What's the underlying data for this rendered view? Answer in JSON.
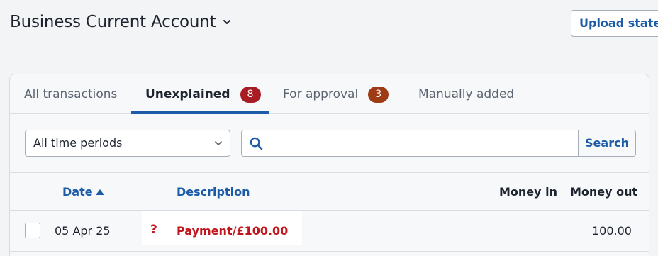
{
  "header": {
    "title": "Business Current Account",
    "upload_label": "Upload statement"
  },
  "tabs": [
    {
      "label": "All transactions"
    },
    {
      "label": "Unexplained",
      "badge": "8",
      "badge_color": "#a81c23"
    },
    {
      "label": "For approval",
      "badge": "3",
      "badge_color": "#9e3a14"
    },
    {
      "label": "Manually added"
    }
  ],
  "filters": {
    "period_value": "All time periods",
    "search_placeholder": "",
    "search_button": "Search"
  },
  "table": {
    "columns": {
      "date": "Date",
      "description": "Description",
      "money_in": "Money in",
      "money_out": "Money out"
    },
    "rows": [
      {
        "date": "05 Apr 25",
        "status_icon": "question-icon",
        "status_symbol": "?",
        "description": "Payment/£100.00",
        "money_in": "",
        "money_out": "100.00"
      }
    ]
  },
  "colors": {
    "accent": "#1b5ba8",
    "unexplained": "#c2161d"
  }
}
